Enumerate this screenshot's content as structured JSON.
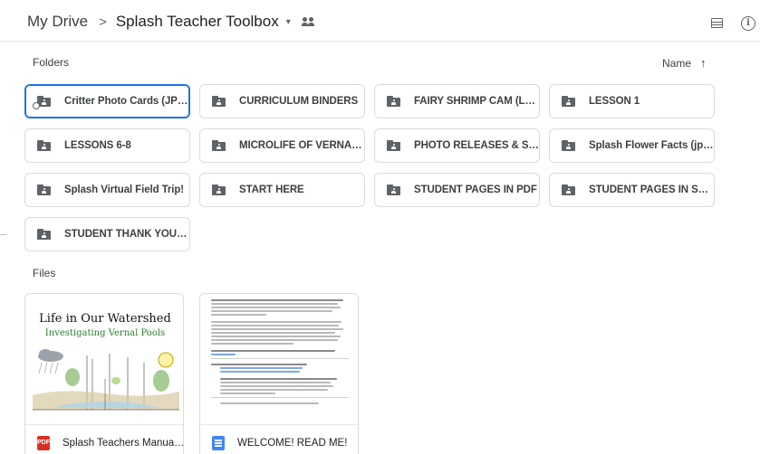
{
  "header": {
    "root": "My Drive",
    "separator": ">",
    "current_folder": "Splash Teacher Toolbox",
    "caret": "▾"
  },
  "toolbar": {
    "list_view_icon": "list-view-icon",
    "info_icon": "info-icon"
  },
  "sections": {
    "folders_label": "Folders",
    "files_label": "Files",
    "sort_label": "Name",
    "sort_arrow": "↑"
  },
  "folders": [
    {
      "name": "Critter Photo Cards (JPEG)",
      "selected": true,
      "shortcut": true
    },
    {
      "name": "CURRICULUM BINDERS"
    },
    {
      "name": "FAIRY SHRIMP CAM (Lesson..."
    },
    {
      "name": "LESSON 1"
    },
    {
      "name": "LESSONS 6-8"
    },
    {
      "name": "MICROLIFE OF VERNAL POO..."
    },
    {
      "name": "PHOTO RELEASES & STAND..."
    },
    {
      "name": "Splash Flower Facts (jpeg im..."
    },
    {
      "name": "Splash Virtual Field Trip!"
    },
    {
      "name": "START HERE"
    },
    {
      "name": "STUDENT PAGES IN PDF"
    },
    {
      "name": "STUDENT PAGES IN SLIDES"
    },
    {
      "name": "STUDENT THANK YOU NOTES"
    }
  ],
  "files": [
    {
      "name": "Splash Teachers Manual.pdf",
      "type_icon": "pdf-icon",
      "thumb_title": "Life in Our Watershed",
      "thumb_subtitle": "Investigating Vernal Pools"
    },
    {
      "name": "WELCOME! READ ME!",
      "type_icon": "google-docs-icon"
    }
  ],
  "colors": {
    "accent_blue": "#1a73e8",
    "icon_gray": "#5f6368",
    "border": "#dadce0",
    "pdf_red": "#d93025",
    "docs_blue": "#4285f4",
    "subtitle_green": "#2e7d32"
  }
}
